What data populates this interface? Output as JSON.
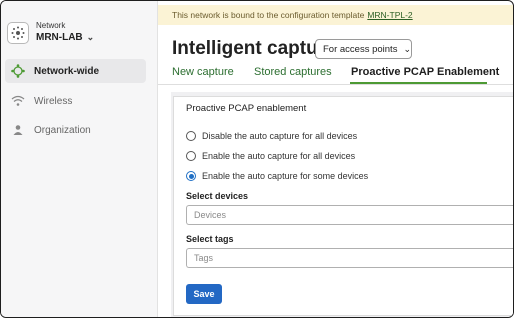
{
  "network": {
    "label": "Network",
    "name": "MRN-LAB"
  },
  "sidebar": {
    "items": [
      {
        "label": "Network-wide",
        "icon": "network-wide-icon",
        "active": true
      },
      {
        "label": "Wireless",
        "icon": "wifi-icon",
        "active": false
      },
      {
        "label": "Organization",
        "icon": "organization-icon",
        "active": false
      }
    ]
  },
  "banner": {
    "text": "This network is bound to the configuration template",
    "link": "MRN-TPL-2"
  },
  "header": {
    "title": "Intelligent capture",
    "scope_select": "For access points"
  },
  "tabs": [
    {
      "label": "New capture"
    },
    {
      "label": "Stored captures"
    },
    {
      "label": "Proactive PCAP Enablement",
      "active": true
    }
  ],
  "card": {
    "title": "Proactive PCAP enablement",
    "options": [
      {
        "label": "Disable the auto capture for all devices",
        "checked": false
      },
      {
        "label": "Enable the auto capture for all devices",
        "checked": false
      },
      {
        "label": "Enable the auto capture for some devices",
        "checked": true
      }
    ],
    "devices_label": "Select devices",
    "devices_placeholder": "Devices",
    "tags_label": "Select tags",
    "tags_placeholder": "Tags",
    "save_label": "Save"
  },
  "colors": {
    "accent_green": "#4d9a34",
    "primary_blue": "#2368c4",
    "banner_bg": "#fbf3d5"
  }
}
